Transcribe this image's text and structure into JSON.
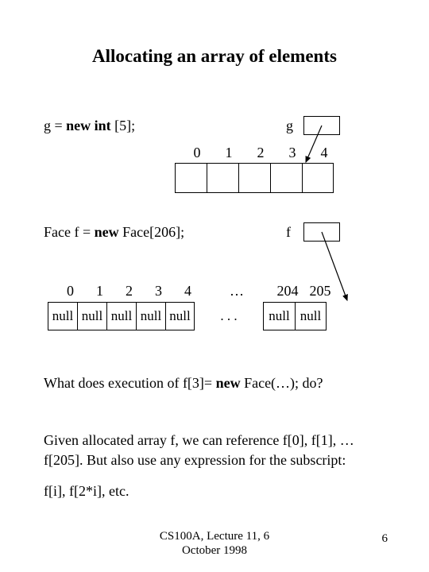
{
  "title": "Allocating an array of elements",
  "g": {
    "decl_prefix": "g =  ",
    "decl_bold": "new int",
    "decl_suffix": " [5];",
    "label": "g",
    "indices": [
      "0",
      "1",
      "2",
      "3",
      "4"
    ]
  },
  "f": {
    "decl_prefix": "Face f = ",
    "decl_bold": "new",
    "decl_suffix": " Face[206];",
    "label": "f",
    "indices": [
      "0",
      "1",
      "2",
      "3",
      "4",
      "…",
      "204",
      "205"
    ],
    "cells_left": [
      "null",
      "null",
      "null",
      "null",
      "null"
    ],
    "ellipsis": ". . .",
    "cells_right": [
      "null",
      "null"
    ]
  },
  "question_prefix": "What does execution of   f[3]= ",
  "question_bold": "new",
  "question_suffix": " Face(…);   do?",
  "paragraph": "Given allocated array f, we can reference f[0], f[1], … f[205]. But also use any expression for the subscript:",
  "paragraph2": "f[i], f[2*i], etc.",
  "footer_line1": "CS100A, Lecture 11, 6",
  "footer_line2": "October 1998",
  "page_number": "6"
}
